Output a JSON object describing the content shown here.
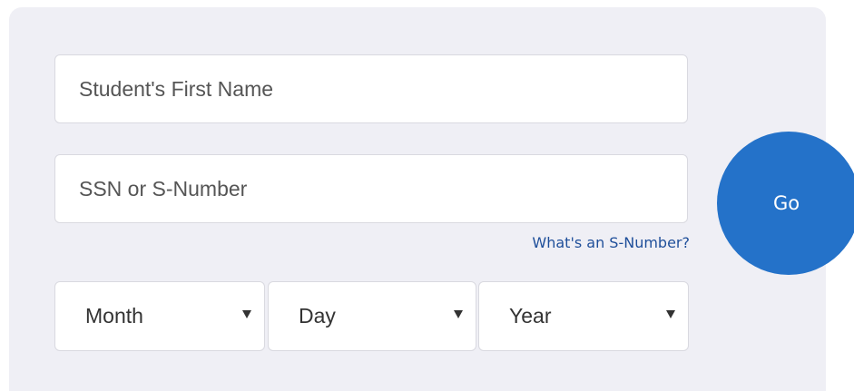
{
  "form": {
    "first_name": {
      "value": "",
      "placeholder": "Student's First Name"
    },
    "ssn": {
      "value": "",
      "placeholder": "SSN or S-Number"
    },
    "help_link": "What's an S-Number?",
    "birthdate": {
      "month": {
        "selected": "Month"
      },
      "day": {
        "selected": "Day"
      },
      "year": {
        "selected": "Year"
      }
    },
    "go_label": "Go"
  },
  "icons": {
    "dropdown": "chevron-down-icon"
  },
  "colors": {
    "panel_background": "#efeff5",
    "accent": "#2472c9",
    "link": "#1f4f9a",
    "field_border": "#d9d9e0"
  }
}
